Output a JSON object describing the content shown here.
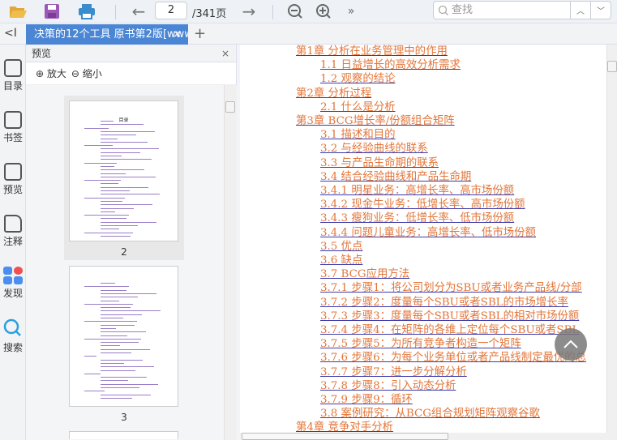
{
  "toolbar": {
    "page_current": "2",
    "page_total": "/341页",
    "search_placeholder": "查找"
  },
  "tab": {
    "title": "决策的12个工具 原书第2版[www",
    "close": "×",
    "add": "+",
    "collapse": "<I"
  },
  "rail": [
    {
      "label": "目录"
    },
    {
      "label": "书签"
    },
    {
      "label": "预览"
    },
    {
      "label": "注释"
    },
    {
      "label": "发现"
    },
    {
      "label": "搜索"
    }
  ],
  "panel": {
    "title": "预览",
    "close": "×",
    "zoom_in": "放大",
    "zoom_out": "缩小",
    "thumb_title": "目录",
    "pages": [
      "2",
      "3"
    ]
  },
  "toc": [
    {
      "text": "第1章 分析在业务管理中的作用",
      "level": 1
    },
    {
      "text": "1.1 日益增长的高效分析需求",
      "level": 2
    },
    {
      "text": "1.2 观察的结论",
      "level": 2
    },
    {
      "text": "第2章 分析过程",
      "level": 1
    },
    {
      "text": "2.1 什么是分析",
      "level": 2
    },
    {
      "text": "第3章 BCG增长率/份额组合矩阵",
      "level": 1
    },
    {
      "text": "3.1 描述和目的",
      "level": 2
    },
    {
      "text": "3.2 与经验曲线的联系",
      "level": 2
    },
    {
      "text": "3.3 与产品生命期的联系",
      "level": 2
    },
    {
      "text": "3.4 结合经验曲线和产品生命期",
      "level": 2
    },
    {
      "text": "3.4.1 明星业务：高增长率、高市场份额",
      "level": 2
    },
    {
      "text": "3.4.2 现金牛业务：低增长率、高市场份额",
      "level": 2
    },
    {
      "text": "3.4.3 瘦狗业务：低增长率、低市场份额",
      "level": 2
    },
    {
      "text": "3.4.4 问题儿童业务：高增长率、低市场份额",
      "level": 2
    },
    {
      "text": "3.5 优点",
      "level": 2
    },
    {
      "text": "3.6 缺点",
      "level": 2
    },
    {
      "text": "3.7 BCG应用方法",
      "level": 2
    },
    {
      "text": "3.7.1 步骤1：将公司划分为SBU或者业务产品线/分部",
      "level": 2
    },
    {
      "text": "3.7.2 步骤2：度量每个SBU或者SBL的市场增长率",
      "level": 2
    },
    {
      "text": "3.7.3 步骤3：度量每个SBU或者SBL的相对市场份额",
      "level": 2
    },
    {
      "text": "3.7.4 步骤4：在矩阵的各维上定位每个SBU或者SBL",
      "level": 2
    },
    {
      "text": "3.7.5 步骤5：为所有竞争者构造一个矩阵",
      "level": 2
    },
    {
      "text": "3.7.6 步骤6：为每个业务单位或者产品线制定最优的总",
      "level": 2
    },
    {
      "text": "3.7.7 步骤7：进一步分解分析",
      "level": 2
    },
    {
      "text": "3.7.8 步骤8：引入动态分析",
      "level": 2
    },
    {
      "text": "3.7.9 步骤9：循环",
      "level": 2
    },
    {
      "text": "3.8 案例研究：从BCG组合规划矩阵观察谷歌",
      "level": 2
    },
    {
      "text": "第4章 竞争对手分析",
      "level": 1
    }
  ]
}
